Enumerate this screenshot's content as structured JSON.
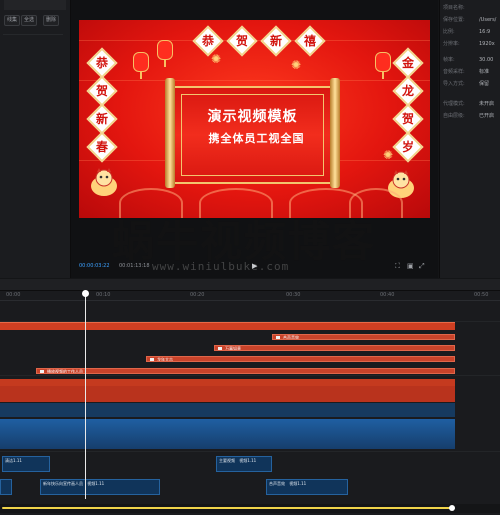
{
  "media_panel": {
    "chip1": "线集",
    "chip2": "全选",
    "chip3": "删除"
  },
  "video": {
    "title": "演示视频模板",
    "subtitle": "携全体员工视全国",
    "left_chars": [
      "恭",
      "贺",
      "新",
      "春"
    ],
    "top_chars": [
      "恭",
      "贺",
      "新",
      "禧"
    ],
    "right_chars": [
      "金",
      "龙",
      "贺",
      "岁"
    ]
  },
  "transport": {
    "current_tc": "00:00:03:22",
    "total_tc": "00:01:13:18",
    "play_icon": "play-icon"
  },
  "watermark": {
    "text": "蜗牛视频博客",
    "url": "www.winiulbuke.com"
  },
  "inspector": {
    "rows": [
      {
        "k": "项目名称:",
        "v": ""
      },
      {
        "k": "保存位置:",
        "v": "/Users/"
      },
      {
        "k": "比例:",
        "v": "16:9"
      },
      {
        "k": "分辨率:",
        "v": "1920x"
      },
      {
        "k": "帧率:",
        "v": "30.00"
      },
      {
        "k": "音频采样:",
        "v": "标准"
      },
      {
        "k": "导入方式:",
        "v": "保留"
      },
      {
        "k": "代理模式:",
        "v": "未开启"
      },
      {
        "k": "自由层级:",
        "v": "已开启"
      }
    ]
  },
  "timeline": {
    "ruler": [
      "00:00",
      "00:10",
      "00:20",
      "00:30",
      "00:40",
      "00:50"
    ],
    "orange_clips": [
      "合声音效",
      "万事如意",
      "龙年大吉",
      "播放视频的工作人员"
    ],
    "small_clips": [
      "清洁1.11",
      "主要视频",
      "视频1.11",
      "新年快乐向宣传画人员",
      "视频1.11",
      "合声音效",
      "视频1.11"
    ]
  }
}
